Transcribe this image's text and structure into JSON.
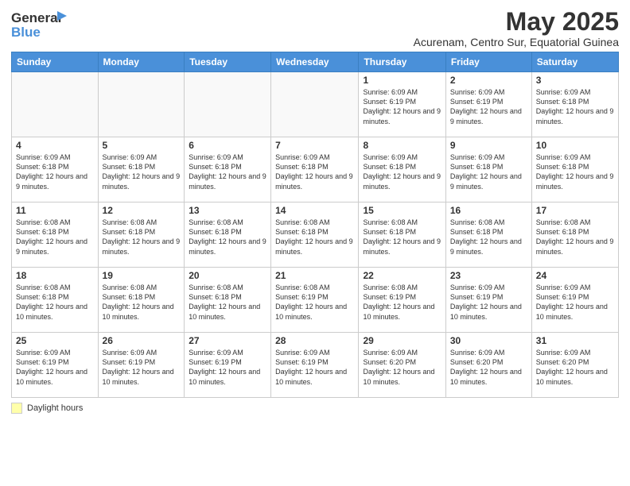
{
  "header": {
    "logo_general": "General",
    "logo_blue": "Blue",
    "title": "May 2025",
    "subtitle": "Acurenam, Centro Sur, Equatorial Guinea"
  },
  "days_of_week": [
    "Sunday",
    "Monday",
    "Tuesday",
    "Wednesday",
    "Thursday",
    "Friday",
    "Saturday"
  ],
  "weeks": [
    [
      {
        "day": "",
        "info": ""
      },
      {
        "day": "",
        "info": ""
      },
      {
        "day": "",
        "info": ""
      },
      {
        "day": "",
        "info": ""
      },
      {
        "day": "1",
        "info": "Sunrise: 6:09 AM\nSunset: 6:19 PM\nDaylight: 12 hours and 9 minutes."
      },
      {
        "day": "2",
        "info": "Sunrise: 6:09 AM\nSunset: 6:19 PM\nDaylight: 12 hours and 9 minutes."
      },
      {
        "day": "3",
        "info": "Sunrise: 6:09 AM\nSunset: 6:18 PM\nDaylight: 12 hours and 9 minutes."
      }
    ],
    [
      {
        "day": "4",
        "info": "Sunrise: 6:09 AM\nSunset: 6:18 PM\nDaylight: 12 hours and 9 minutes."
      },
      {
        "day": "5",
        "info": "Sunrise: 6:09 AM\nSunset: 6:18 PM\nDaylight: 12 hours and 9 minutes."
      },
      {
        "day": "6",
        "info": "Sunrise: 6:09 AM\nSunset: 6:18 PM\nDaylight: 12 hours and 9 minutes."
      },
      {
        "day": "7",
        "info": "Sunrise: 6:09 AM\nSunset: 6:18 PM\nDaylight: 12 hours and 9 minutes."
      },
      {
        "day": "8",
        "info": "Sunrise: 6:09 AM\nSunset: 6:18 PM\nDaylight: 12 hours and 9 minutes."
      },
      {
        "day": "9",
        "info": "Sunrise: 6:09 AM\nSunset: 6:18 PM\nDaylight: 12 hours and 9 minutes."
      },
      {
        "day": "10",
        "info": "Sunrise: 6:09 AM\nSunset: 6:18 PM\nDaylight: 12 hours and 9 minutes."
      }
    ],
    [
      {
        "day": "11",
        "info": "Sunrise: 6:08 AM\nSunset: 6:18 PM\nDaylight: 12 hours and 9 minutes."
      },
      {
        "day": "12",
        "info": "Sunrise: 6:08 AM\nSunset: 6:18 PM\nDaylight: 12 hours and 9 minutes."
      },
      {
        "day": "13",
        "info": "Sunrise: 6:08 AM\nSunset: 6:18 PM\nDaylight: 12 hours and 9 minutes."
      },
      {
        "day": "14",
        "info": "Sunrise: 6:08 AM\nSunset: 6:18 PM\nDaylight: 12 hours and 9 minutes."
      },
      {
        "day": "15",
        "info": "Sunrise: 6:08 AM\nSunset: 6:18 PM\nDaylight: 12 hours and 9 minutes."
      },
      {
        "day": "16",
        "info": "Sunrise: 6:08 AM\nSunset: 6:18 PM\nDaylight: 12 hours and 9 minutes."
      },
      {
        "day": "17",
        "info": "Sunrise: 6:08 AM\nSunset: 6:18 PM\nDaylight: 12 hours and 9 minutes."
      }
    ],
    [
      {
        "day": "18",
        "info": "Sunrise: 6:08 AM\nSunset: 6:18 PM\nDaylight: 12 hours and 10 minutes."
      },
      {
        "day": "19",
        "info": "Sunrise: 6:08 AM\nSunset: 6:18 PM\nDaylight: 12 hours and 10 minutes."
      },
      {
        "day": "20",
        "info": "Sunrise: 6:08 AM\nSunset: 6:18 PM\nDaylight: 12 hours and 10 minutes."
      },
      {
        "day": "21",
        "info": "Sunrise: 6:08 AM\nSunset: 6:19 PM\nDaylight: 12 hours and 10 minutes."
      },
      {
        "day": "22",
        "info": "Sunrise: 6:08 AM\nSunset: 6:19 PM\nDaylight: 12 hours and 10 minutes."
      },
      {
        "day": "23",
        "info": "Sunrise: 6:09 AM\nSunset: 6:19 PM\nDaylight: 12 hours and 10 minutes."
      },
      {
        "day": "24",
        "info": "Sunrise: 6:09 AM\nSunset: 6:19 PM\nDaylight: 12 hours and 10 minutes."
      }
    ],
    [
      {
        "day": "25",
        "info": "Sunrise: 6:09 AM\nSunset: 6:19 PM\nDaylight: 12 hours and 10 minutes."
      },
      {
        "day": "26",
        "info": "Sunrise: 6:09 AM\nSunset: 6:19 PM\nDaylight: 12 hours and 10 minutes."
      },
      {
        "day": "27",
        "info": "Sunrise: 6:09 AM\nSunset: 6:19 PM\nDaylight: 12 hours and 10 minutes."
      },
      {
        "day": "28",
        "info": "Sunrise: 6:09 AM\nSunset: 6:19 PM\nDaylight: 12 hours and 10 minutes."
      },
      {
        "day": "29",
        "info": "Sunrise: 6:09 AM\nSunset: 6:20 PM\nDaylight: 12 hours and 10 minutes."
      },
      {
        "day": "30",
        "info": "Sunrise: 6:09 AM\nSunset: 6:20 PM\nDaylight: 12 hours and 10 minutes."
      },
      {
        "day": "31",
        "info": "Sunrise: 6:09 AM\nSunset: 6:20 PM\nDaylight: 12 hours and 10 minutes."
      }
    ]
  ],
  "footer": {
    "daylight_label": "Daylight hours"
  }
}
